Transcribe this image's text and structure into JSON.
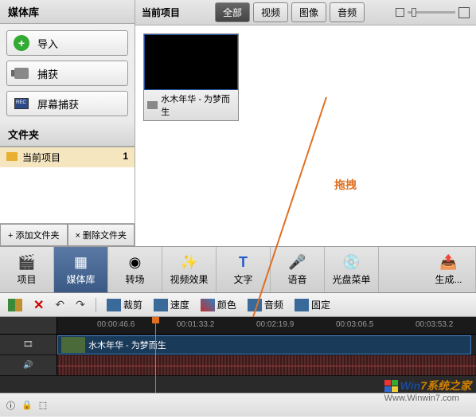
{
  "left": {
    "media_header": "媒体库",
    "import": "导入",
    "capture": "捕获",
    "screencap": "屏幕捕获",
    "folder_header": "文件夹",
    "folder_name": "当前项目",
    "folder_count": "1",
    "add_folder": "+ 添加文件夹",
    "del_folder": "× 删除文件夹"
  },
  "right": {
    "header": "当前项目",
    "tabs": {
      "all": "全部",
      "video": "视频",
      "image": "图像",
      "audio": "音频"
    },
    "thumb_label": "水木年华 - 为梦而生"
  },
  "annot": {
    "drag": "拖拽"
  },
  "toolbar": {
    "project": "项目",
    "media": "媒体库",
    "transition": "转场",
    "vfx": "视频效果",
    "text": "文字",
    "voice": "语音",
    "disc": "光盘菜单",
    "export": "生成..."
  },
  "toolbar2": {
    "crop": "裁剪",
    "speed": "速度",
    "color": "颜色",
    "audio": "音频",
    "freeze": "固定"
  },
  "timeline": {
    "marks": [
      "00:00:46.6",
      "00:01:33.2",
      "00:02:19.9",
      "00:03:06.5",
      "00:03:53.2"
    ],
    "clip_title": "水木年华 - 为梦而生"
  },
  "watermark": {
    "brand1": "Win",
    "brand2": "7系统之家",
    "url": "Www.Winwin7.com"
  }
}
